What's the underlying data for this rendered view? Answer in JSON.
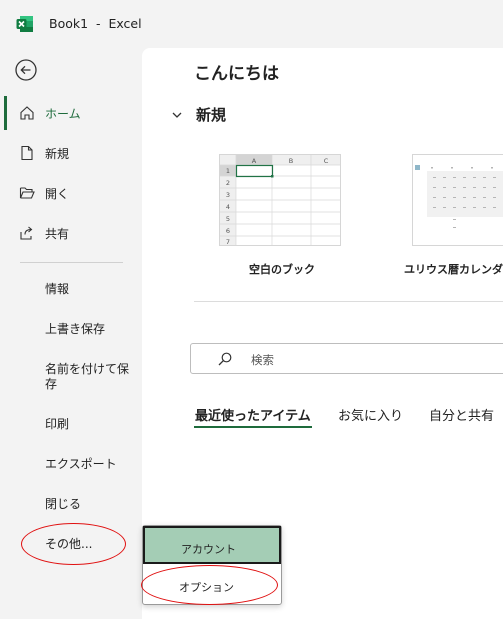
{
  "title_bar": {
    "title": "Book1  -  Excel"
  },
  "sidebar": {
    "nav": [
      {
        "label": "ホーム",
        "icon": "home-icon"
      },
      {
        "label": "新規",
        "icon": "new-file-icon"
      },
      {
        "label": "開く",
        "icon": "folder-open-icon"
      },
      {
        "label": "共有",
        "icon": "share-icon"
      }
    ],
    "more": [
      {
        "label": "情報"
      },
      {
        "label": "上書き保存"
      },
      {
        "label": "名前を付けて保存"
      },
      {
        "label": "印刷"
      },
      {
        "label": "エクスポート"
      },
      {
        "label": "閉じる"
      },
      {
        "label": "その他..."
      }
    ]
  },
  "main": {
    "greeting": "こんにちは",
    "new_section": "新規",
    "templates": [
      {
        "label": "空白のブック"
      },
      {
        "label": "ユリウス暦カレンダー"
      }
    ],
    "blank_preview": {
      "columns": [
        "A",
        "B",
        "C"
      ],
      "rows": [
        "1",
        "2",
        "3",
        "4",
        "5",
        "6",
        "7"
      ]
    },
    "search_placeholder": "検索",
    "tabs": [
      {
        "label": "最近使ったアイテム"
      },
      {
        "label": "お気に入り"
      },
      {
        "label": "自分と共有"
      }
    ]
  },
  "popup": {
    "items": [
      {
        "label": "アカウント"
      },
      {
        "label": "オプション"
      }
    ]
  },
  "colors": {
    "accent": "#1e6b3c",
    "highlight": "#a4cdb5",
    "annotation": "#e01010"
  }
}
